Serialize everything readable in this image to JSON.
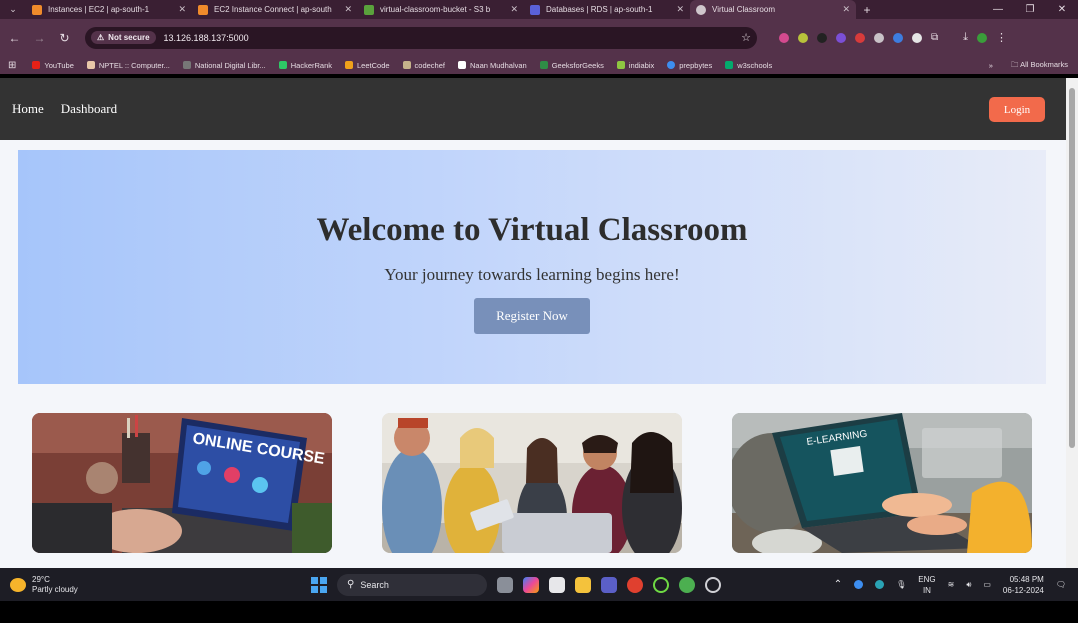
{
  "browser": {
    "tabs": [
      {
        "label": "Instances | EC2 | ap-south-1",
        "color": "#f08b2b",
        "active": false
      },
      {
        "label": "EC2 Instance Connect | ap-south",
        "color": "#f08b2b",
        "active": false
      },
      {
        "label": "virtual-classroom-bucket - S3 b",
        "color": "#5aa23c",
        "active": false
      },
      {
        "label": "Databases | RDS | ap-south-1",
        "color": "#5a61d8",
        "active": false
      },
      {
        "label": "Virtual Classroom",
        "color": "#cfc6cc",
        "active": true
      }
    ],
    "tab_close": "✕",
    "new_tab": "+",
    "window_controls": {
      "minimize": "—",
      "restore": "❐",
      "close": "✕"
    },
    "security_label": "Not secure",
    "url": "13.126.188.137:5000",
    "bookmarks": [
      {
        "label": "YouTube",
        "color": "#e62117"
      },
      {
        "label": "NPTEL :: Computer...",
        "color": "#e9c7a8"
      },
      {
        "label": "National Digital Libr...",
        "color": "#777"
      },
      {
        "label": "HackerRank",
        "color": "#2ec866"
      },
      {
        "label": "LeetCode",
        "color": "#f0a21b"
      },
      {
        "label": "codechef",
        "color": "#c6b38b"
      },
      {
        "label": "Naan Mudhalvan",
        "color": "#ffffff"
      },
      {
        "label": "GeeksforGeeks",
        "color": "#2f8d46"
      },
      {
        "label": "indiabix",
        "color": "#8ec641"
      },
      {
        "label": "prepbytes",
        "color": "#3d8ef0"
      },
      {
        "label": "w3schools",
        "color": "#04aa6d"
      }
    ],
    "all_bookmarks": "All Bookmarks",
    "more": "»"
  },
  "site": {
    "nav": {
      "home": "Home",
      "dashboard": "Dashboard",
      "login": "Login"
    },
    "hero": {
      "title": "Welcome to Virtual Classroom",
      "subtitle": "Your journey towards learning begins here!",
      "cta": "Register Now"
    },
    "cards": [
      {
        "image": "online-course-laptop",
        "text": "ONLINE COURSE"
      },
      {
        "image": "students-group"
      },
      {
        "image": "e-learning-laptop",
        "text": "E-LEARNING"
      }
    ]
  },
  "taskbar": {
    "temperature": "29°C",
    "weather": "Partly cloudy",
    "search": "Search",
    "language": "ENG",
    "region": "IN",
    "time": "05:48 PM",
    "date": "06-12-2024"
  },
  "colors": {
    "nav_bg": "#333333",
    "login_btn": "#f26a4b",
    "register_btn": "#7890ba",
    "hero_start": "#a6c5fa",
    "hero_end": "#e8ecf8"
  }
}
